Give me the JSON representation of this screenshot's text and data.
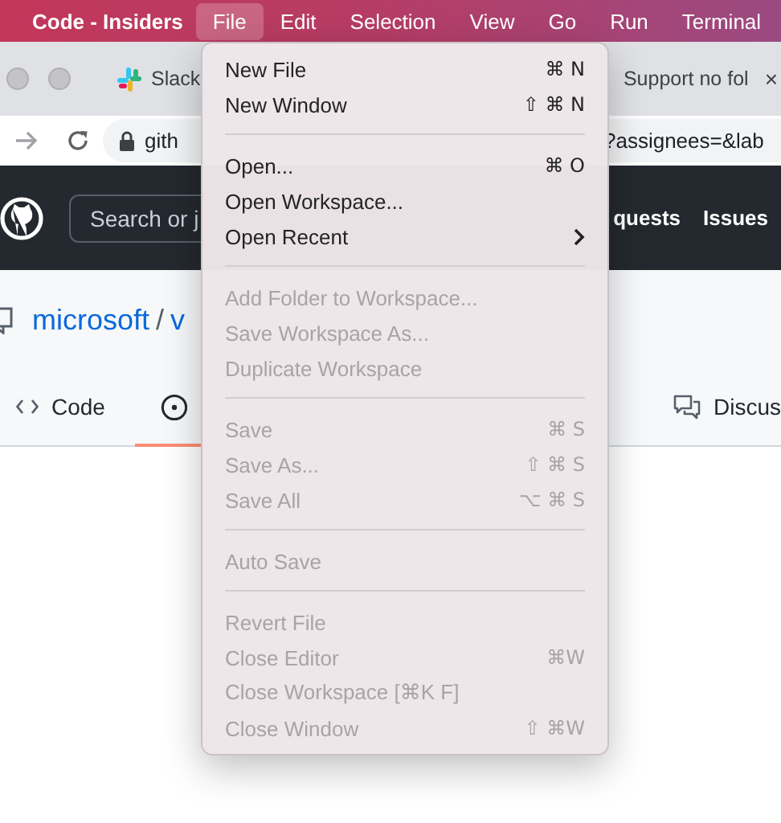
{
  "menu_bar": {
    "app_name": "Code - Insiders",
    "items": [
      {
        "label": "File",
        "selected": true
      },
      {
        "label": "Edit",
        "selected": false
      },
      {
        "label": "Selection",
        "selected": false
      },
      {
        "label": "View",
        "selected": false
      },
      {
        "label": "Go",
        "selected": false
      },
      {
        "label": "Run",
        "selected": false
      },
      {
        "label": "Terminal",
        "selected": false
      }
    ]
  },
  "browser": {
    "tabs": [
      {
        "kind": "slack",
        "label": "Slack"
      },
      {
        "kind": "page",
        "label": "Support no fol",
        "close": "×"
      }
    ],
    "address_start": "gith",
    "address_end": "?assignees=&lab"
  },
  "github": {
    "search_placeholder": "Search or j",
    "nav": [
      "quests",
      "Issues"
    ],
    "owner": "microsoft",
    "separator": "/",
    "repo": "v",
    "tabs": [
      {
        "kind": "code",
        "label": "Code",
        "selected": false
      },
      {
        "kind": "issue",
        "selected": true
      },
      {
        "kind": "discussion",
        "label": "Discus",
        "selected": false
      }
    ]
  },
  "file_menu": {
    "entries": [
      {
        "kind": "item",
        "label": "New File",
        "shortcut": "⌘ N",
        "disabled": false
      },
      {
        "kind": "item",
        "label": "New Window",
        "shortcut": "⇧ ⌘ N",
        "disabled": false
      },
      {
        "kind": "separator"
      },
      {
        "kind": "item",
        "label": "Open...",
        "shortcut": "⌘ O",
        "disabled": false
      },
      {
        "kind": "item",
        "label": "Open Workspace...",
        "disabled": false
      },
      {
        "kind": "submenu",
        "label": "Open Recent",
        "disabled": false
      },
      {
        "kind": "separator"
      },
      {
        "kind": "item",
        "label": "Add Folder to Workspace...",
        "disabled": true
      },
      {
        "kind": "item",
        "label": "Save Workspace As...",
        "disabled": true
      },
      {
        "kind": "item",
        "label": "Duplicate Workspace",
        "disabled": true
      },
      {
        "kind": "separator"
      },
      {
        "kind": "item",
        "label": "Save",
        "shortcut": "⌘ S",
        "disabled": true
      },
      {
        "kind": "item",
        "label": "Save As...",
        "shortcut": "⇧ ⌘ S",
        "disabled": true
      },
      {
        "kind": "item",
        "label": "Save All",
        "shortcut": "⌥ ⌘ S",
        "disabled": true
      },
      {
        "kind": "separator"
      },
      {
        "kind": "item",
        "label": "Auto Save",
        "disabled": true
      },
      {
        "kind": "separator"
      },
      {
        "kind": "item",
        "label": "Revert File",
        "disabled": true
      },
      {
        "kind": "item",
        "label": "Close Editor",
        "shortcut": "⌘W",
        "disabled": true
      },
      {
        "kind": "item",
        "label": "Close Workspace [⌘K F]",
        "disabled": true
      },
      {
        "kind": "item",
        "label": "Close Window",
        "shortcut": "⇧ ⌘W",
        "disabled": true
      }
    ]
  }
}
